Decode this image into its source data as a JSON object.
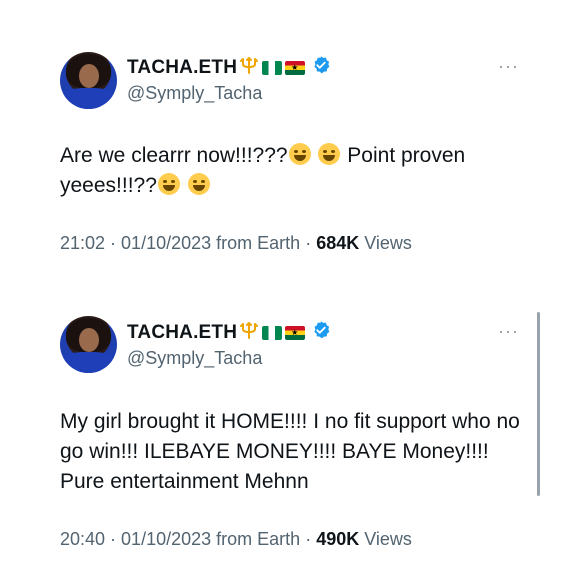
{
  "tweets": [
    {
      "display_name": "TACHA.ETH",
      "handle": "@Symply_Tacha",
      "text": "Are we clearrr now!!!???",
      "text_after_emoji": " Point proven yeees!!!??",
      "time": "21:02",
      "date": "01/10/2023",
      "source": "from Earth",
      "views_count": "684K",
      "views_label": "Views",
      "more_label": "···"
    },
    {
      "display_name": "TACHA.ETH",
      "handle": "@Symply_Tacha",
      "text": "My girl brought it HOME!!!! I no fit support who no go win!!! ILEBAYE MONEY!!!! BAYE Money!!!! Pure entertainment Mehnn",
      "time": "20:40",
      "date": "01/10/2023",
      "source": "from Earth",
      "views_count": "490K",
      "views_label": "Views",
      "more_label": "···"
    }
  ],
  "colors": {
    "text": "#0f1419",
    "secondary": "#536471",
    "verified": "#1d9bf0"
  },
  "icons": [
    "trident-icon",
    "nigeria-flag-icon",
    "ghana-flag-icon",
    "verified-badge-icon",
    "more-icon",
    "rofl-emoji",
    "grin-emoji",
    "joy-emoji"
  ]
}
